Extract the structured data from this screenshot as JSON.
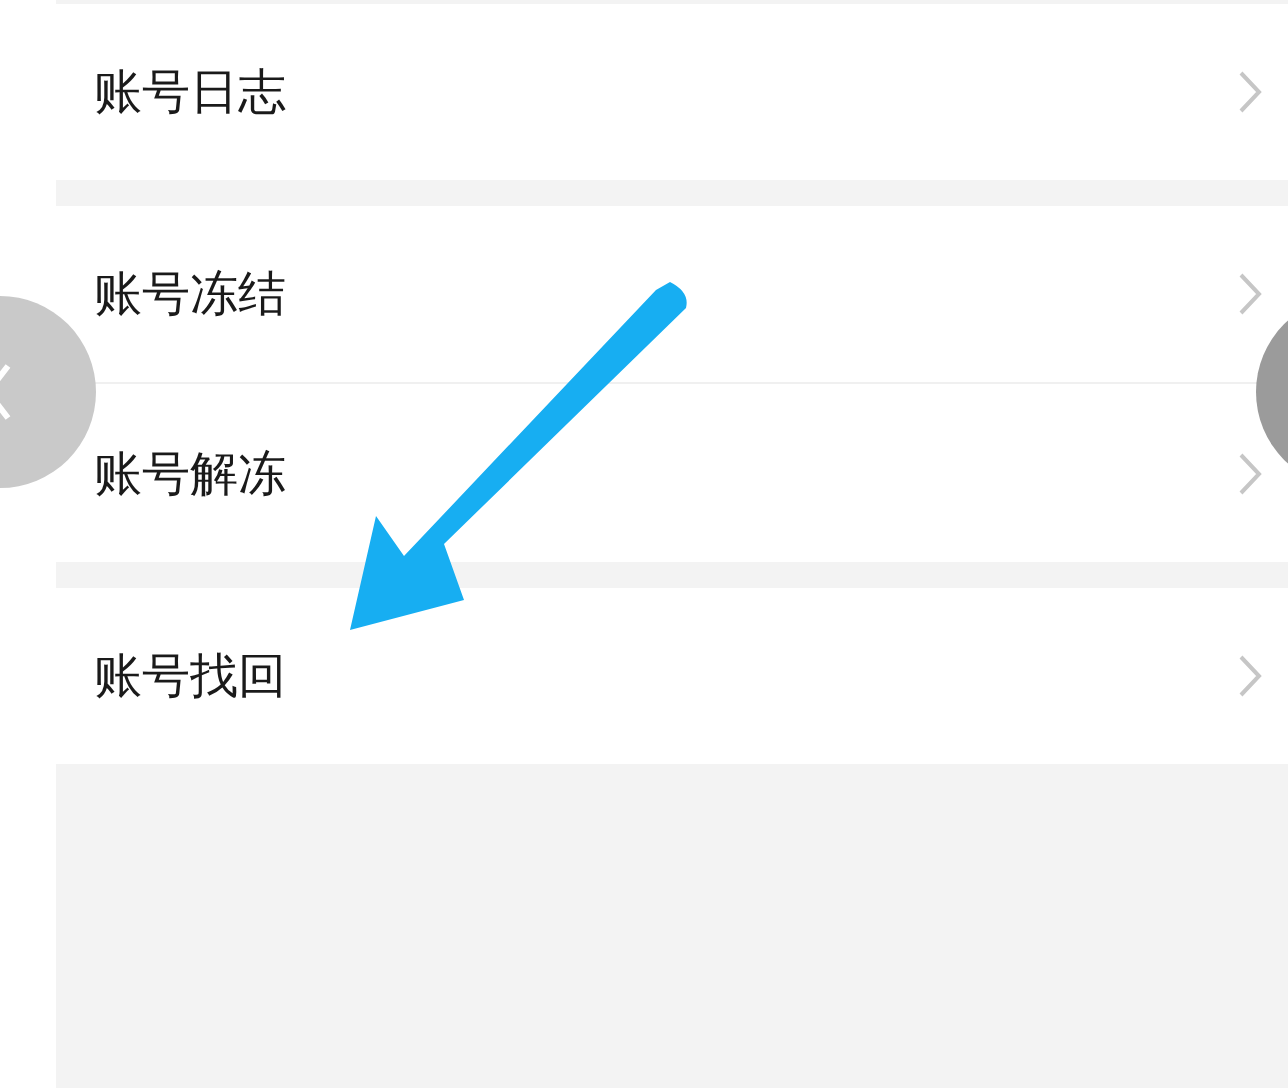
{
  "groups": [
    {
      "items": [
        {
          "label": "账号日志"
        }
      ]
    },
    {
      "items": [
        {
          "label": "账号冻结"
        },
        {
          "label": "账号解冻"
        }
      ]
    },
    {
      "items": [
        {
          "label": "账号找回"
        }
      ]
    }
  ]
}
